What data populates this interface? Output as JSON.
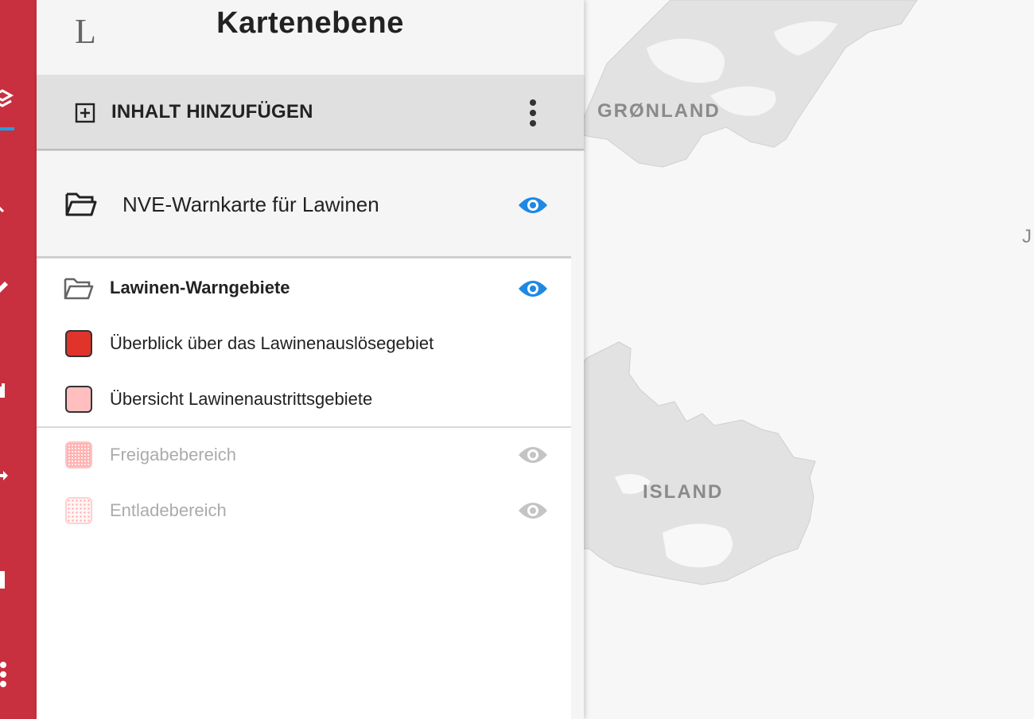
{
  "panel": {
    "logo": "L",
    "title": "Kartenebene",
    "add_content_label": "INHALT HINZUFÜGEN",
    "more_menu_icon": "more-vert-icon"
  },
  "group": {
    "label": "NVE-Warnkarte für Lawinen",
    "icon": "folder-open-icon",
    "visible": true
  },
  "sublayers": [
    {
      "label": "Lawinen-Warngebiete",
      "icon": "folder-open-icon",
      "visible": true
    },
    {
      "label": "Überblick über das Lawinenauslösegebiet",
      "swatch": "#e0342b"
    },
    {
      "label": "Übersicht Lawinenaustrittsgebiete",
      "swatch": "#ffbfbf"
    },
    {
      "label": "Freigabebereich",
      "swatch": "#ffb3b3",
      "visible": false
    },
    {
      "label": "Entladebereich",
      "swatch": "#ffcccc",
      "visible": false
    }
  ],
  "map": {
    "labels": {
      "greenland": "GRØNLAND",
      "iceland": "ISLAND",
      "edge": "J"
    }
  },
  "colors": {
    "rail": "#c8303f",
    "accent": "#1e88e5",
    "active_indicator": "#1aa3e8"
  }
}
